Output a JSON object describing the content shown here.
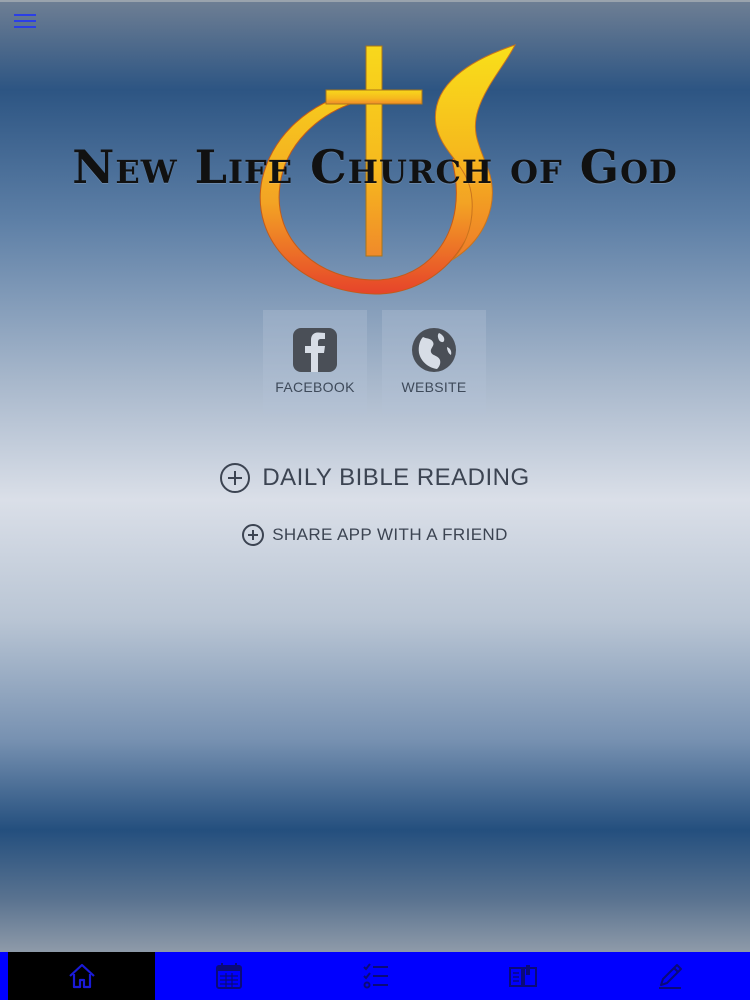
{
  "app": {
    "title": "New Life Church of God"
  },
  "header": {
    "menu_icon": "hamburger-menu-icon"
  },
  "logo": {
    "icon": "cross-and-flame-logo",
    "colors": {
      "cross_top": "#f7d21a",
      "cross_bottom": "#f08a2a",
      "ring_bottom": "#e8402a"
    }
  },
  "tiles": [
    {
      "label": "FACEBOOK",
      "icon": "facebook-icon"
    },
    {
      "label": "WEBSITE",
      "icon": "globe-icon"
    }
  ],
  "links": {
    "daily_bible_reading": "DAILY BIBLE READING",
    "share_app": "SHARE APP WITH A FRIEND"
  },
  "tabbar": {
    "background": "#0000ff",
    "active_background": "#000000",
    "active_index": 0,
    "tabs": [
      {
        "icon": "home-icon"
      },
      {
        "icon": "calendar-icon"
      },
      {
        "icon": "checklist-icon"
      },
      {
        "icon": "open-book-icon"
      },
      {
        "icon": "pencil-icon"
      }
    ]
  }
}
